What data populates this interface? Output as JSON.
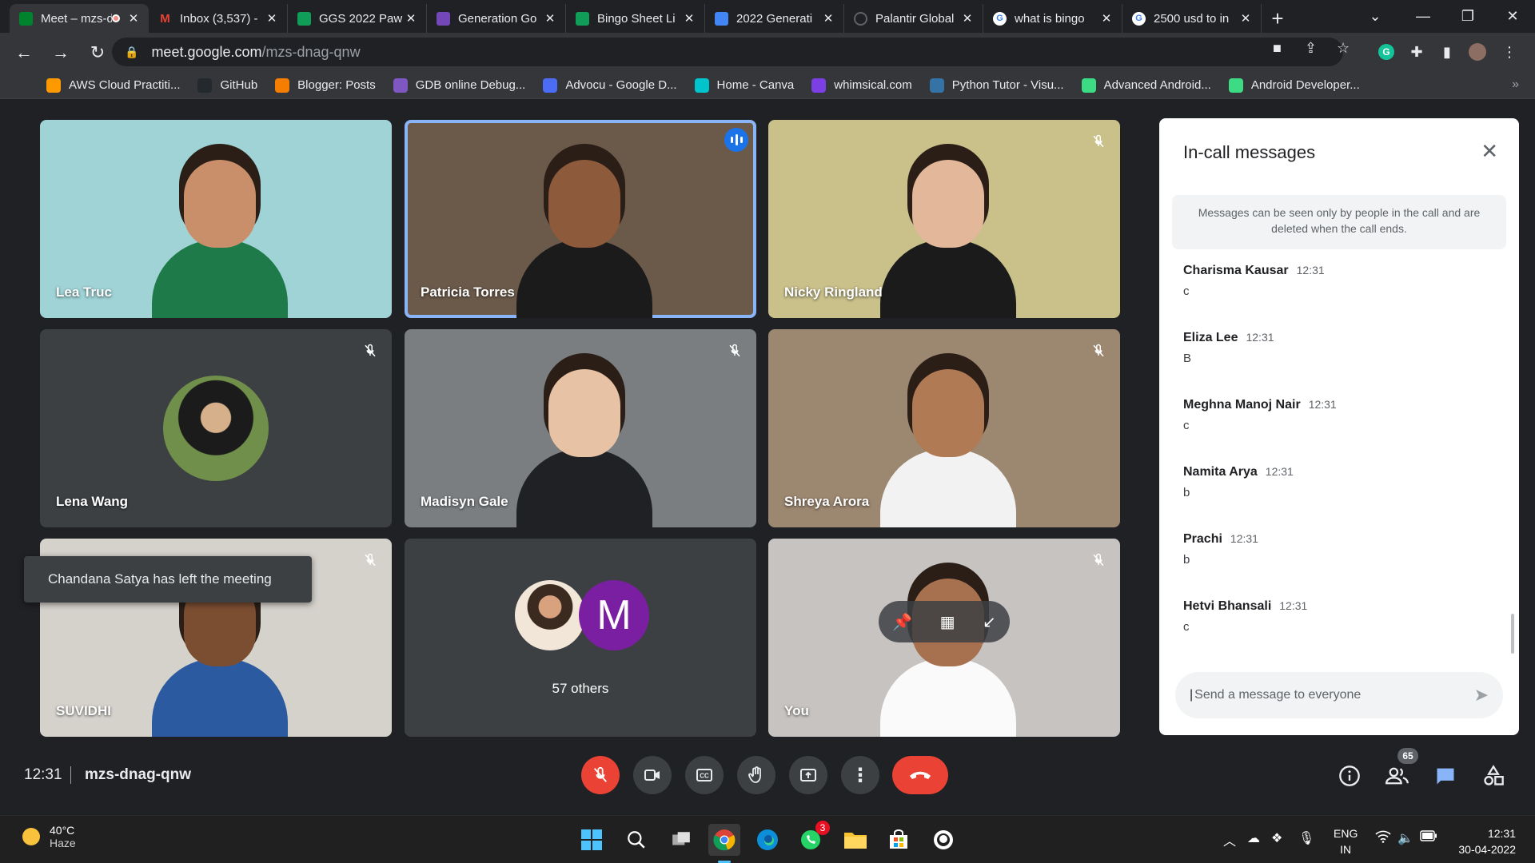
{
  "browser": {
    "tabs": [
      {
        "title": "Meet – mzs-dnag-qnw",
        "icon": "meet-icon",
        "color": "#00832d",
        "active": true
      },
      {
        "title": "Inbox (3,537) -",
        "icon": "gmail-icon",
        "color": "#ea4335"
      },
      {
        "title": "GGS 2022 Paw",
        "icon": "sheets-icon",
        "color": "#0f9d58"
      },
      {
        "title": "Generation Go",
        "icon": "forms-icon",
        "color": "#7248b9"
      },
      {
        "title": "Bingo Sheet Li",
        "icon": "sheets-icon",
        "color": "#0f9d58"
      },
      {
        "title": "2022 Generati",
        "icon": "docs-icon",
        "color": "#4285f4"
      },
      {
        "title": "Palantir Global",
        "icon": "palantir-icon",
        "color": "#202124"
      },
      {
        "title": "what is bingo",
        "icon": "google-icon",
        "color": "#ffffff"
      },
      {
        "title": "2500 usd to in",
        "icon": "google-icon",
        "color": "#ffffff"
      }
    ],
    "url_host": "meet.google.com",
    "url_path": "/mzs-dnag-qnw",
    "bookmarks": [
      {
        "label": "AWS Cloud Practiti...",
        "color": "#ff9900"
      },
      {
        "label": "GitHub",
        "color": "#24292e"
      },
      {
        "label": "Blogger: Posts",
        "color": "#f57d00"
      },
      {
        "label": "GDB online Debug...",
        "color": "#7e57c2"
      },
      {
        "label": "Advocu - Google D...",
        "color": "#4a6cf7"
      },
      {
        "label": "Home - Canva",
        "color": "#00c4cc"
      },
      {
        "label": "whimsical.com",
        "color": "#7b3fe4"
      },
      {
        "label": "Python Tutor - Visu...",
        "color": "#3572a5"
      },
      {
        "label": "Advanced Android...",
        "color": "#3ddc84"
      },
      {
        "label": "Android Developer...",
        "color": "#3ddc84"
      }
    ]
  },
  "participants": [
    {
      "name": "Lea Truc",
      "bg": "#9fd3d6",
      "muted": false
    },
    {
      "name": "Patricia Torres",
      "bg": "#6b5a4a",
      "muted": false,
      "speaking": true
    },
    {
      "name": "Nicky Ringland",
      "bg": "#c9c08a",
      "muted": true
    },
    {
      "name": "Lena Wang",
      "bg": "#3c4043",
      "muted": true,
      "avatar": true
    },
    {
      "name": "Madisyn Gale",
      "bg": "#7a7e80",
      "muted": true
    },
    {
      "name": "Shreya Arora",
      "bg": "#9c8770",
      "muted": true
    },
    {
      "name": "SUVIDHI",
      "bg": "#d5d2cc",
      "muted": true
    },
    {
      "name": "57 others",
      "bg": "#3c4043",
      "muted": false,
      "others": true,
      "initial": "M"
    },
    {
      "name": "You",
      "bg": "#c6c3c0",
      "muted": true
    }
  ],
  "panel": {
    "title": "In-call messages",
    "notice": "Messages can be seen only by people in the call and are deleted when the call ends.",
    "messages": [
      {
        "sender": "Charisma Kausar",
        "time": "12:31",
        "text": "c"
      },
      {
        "sender": "Eliza Lee",
        "time": "12:31",
        "text": "B"
      },
      {
        "sender": "Meghna Manoj Nair",
        "time": "12:31",
        "text": "c"
      },
      {
        "sender": "Namita Arya",
        "time": "12:31",
        "text": "b"
      },
      {
        "sender": "Prachi",
        "time": "12:31",
        "text": "b"
      },
      {
        "sender": "Hetvi Bhansali",
        "time": "12:31",
        "text": "c"
      }
    ],
    "composer_placeholder": "Send a message to everyone"
  },
  "toast": "Chandana Satya has left the meeting",
  "callbar": {
    "time": "12:31",
    "meeting_code": "mzs-dnag-qnw",
    "participant_count": "65"
  },
  "taskbar": {
    "weather_temp": "40°C",
    "weather_desc": "Haze",
    "whatsapp_badge": "3",
    "lang_line1": "ENG",
    "lang_line2": "IN",
    "clock_time": "12:31",
    "clock_date": "30-04-2022"
  }
}
